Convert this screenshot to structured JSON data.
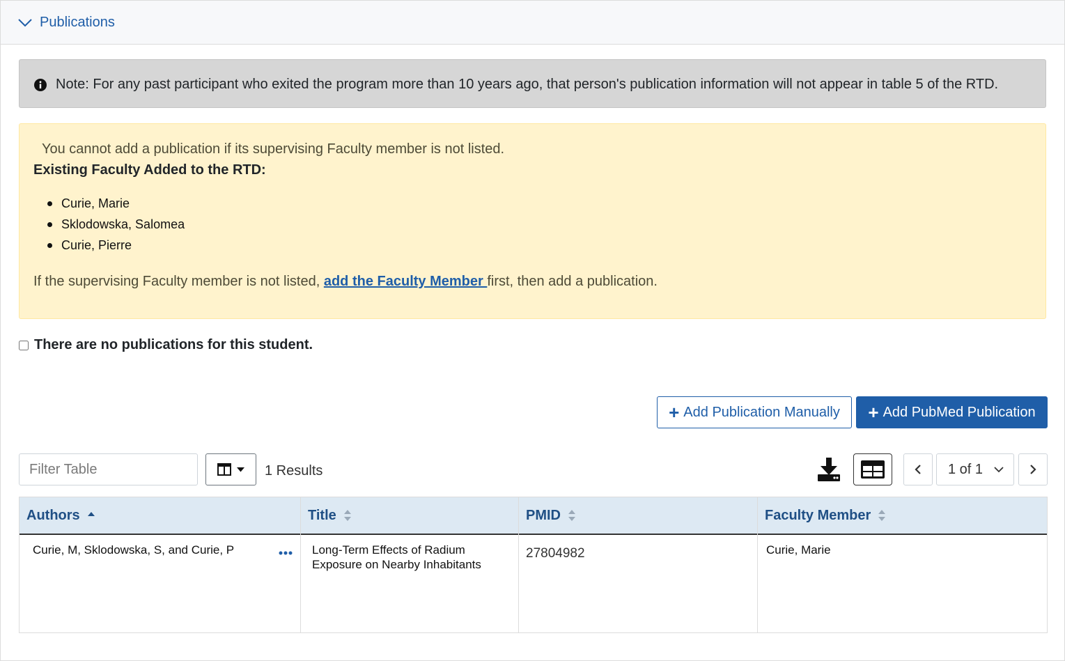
{
  "panel": {
    "title": "Publications"
  },
  "note": {
    "text": "Note: For any past participant who exited the program more than 10 years ago, that person's publication information will not appear in table 5 of the RTD."
  },
  "warning": {
    "line1": "You cannot add a publication if its supervising Faculty member is not listed.",
    "heading": "Existing Faculty Added to the RTD:",
    "faculty": [
      "Curie, Marie",
      "Sklodowska, Salomea",
      "Curie, Pierre"
    ],
    "line3_before": "If the supervising Faculty member is not listed, ",
    "link": "add the Faculty Member ",
    "line3_after": "first, then add a publication."
  },
  "no_publications": {
    "label": "There are no publications for this student."
  },
  "actions": {
    "add_manual": "Add Publication Manually",
    "add_pubmed": "Add PubMed Publication"
  },
  "toolbar": {
    "filter_placeholder": "Filter Table",
    "results": "1 Results",
    "page_label": "1 of 1"
  },
  "table": {
    "columns": [
      "Authors",
      "Title",
      "PMID",
      "Faculty Member"
    ],
    "rows": [
      {
        "authors": "Curie, M, Sklodowska, S, and Curie, P",
        "title_line1": "Long-Term Effects of Radium",
        "title_line2": "Exposure on Nearby Inhabitants",
        "pmid": "27804982",
        "faculty": "Curie, Marie"
      }
    ]
  },
  "colors": {
    "primary": "#1f5ea8",
    "header_bg": "#dde9f3",
    "warning_bg": "#fff3cd",
    "note_bg": "#d6d6d6"
  }
}
